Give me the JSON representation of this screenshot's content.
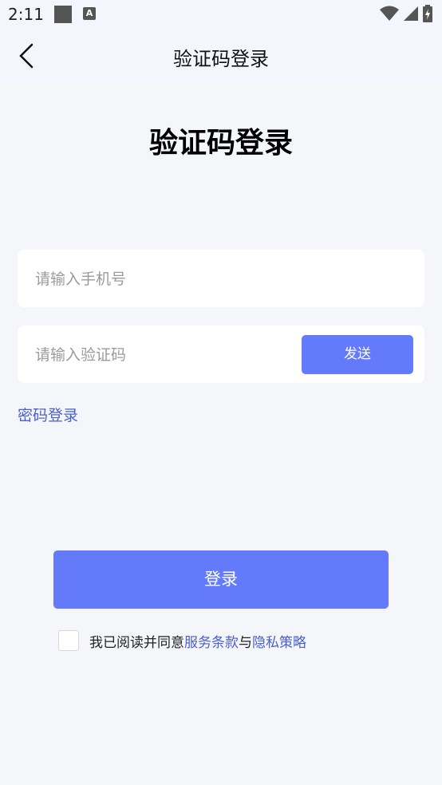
{
  "status_bar": {
    "time": "2:11",
    "notif_letter": "A"
  },
  "app_bar": {
    "title": "验证码登录"
  },
  "page": {
    "heading": "验证码登录"
  },
  "phone_field": {
    "placeholder": "请输入手机号",
    "value": ""
  },
  "code_field": {
    "placeholder": "请输入验证码",
    "value": ""
  },
  "send_button": {
    "label": "发送"
  },
  "password_login_link": {
    "label": "密码登录"
  },
  "login_button": {
    "label": "登录"
  },
  "agreement": {
    "prefix": "我已阅读并同意",
    "terms_link": "服务条款",
    "and": "与",
    "privacy_link": "隐私策略",
    "checked": false
  },
  "colors": {
    "accent": "#637bfb",
    "link": "#4a5fd0",
    "background": "#f4f6fa"
  }
}
